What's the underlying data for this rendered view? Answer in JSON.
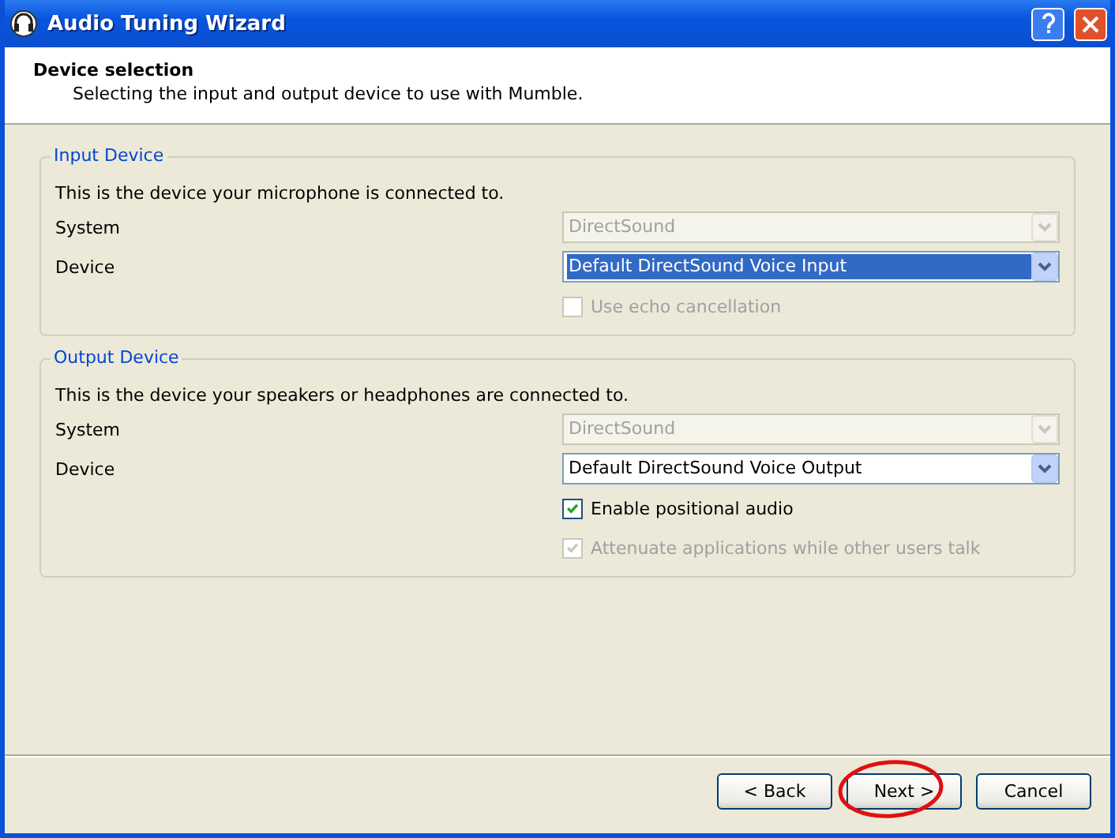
{
  "window": {
    "title": "Audio Tuning Wizard"
  },
  "header": {
    "title": "Device selection",
    "subtitle": "Selecting the input and output device to use with Mumble."
  },
  "groups": [
    {
      "title": "Input Device",
      "description": "This is the device your microphone is connected to.",
      "fields": [
        {
          "label": "System",
          "value": "DirectSound",
          "disabled": true,
          "selected": false
        },
        {
          "label": "Device",
          "value": "Default DirectSound Voice Input",
          "disabled": false,
          "selected": true
        }
      ],
      "checkboxes": [
        {
          "label": "Use echo cancellation",
          "checked": false,
          "disabled": true
        }
      ]
    },
    {
      "title": "Output Device",
      "description": "This is the device your speakers or headphones are connected to.",
      "fields": [
        {
          "label": "System",
          "value": "DirectSound",
          "disabled": true,
          "selected": false
        },
        {
          "label": "Device",
          "value": "Default DirectSound Voice Output",
          "disabled": false,
          "selected": false
        }
      ],
      "checkboxes": [
        {
          "label": "Enable positional audio",
          "checked": true,
          "disabled": false
        },
        {
          "label": "Attenuate applications while other users talk",
          "checked": true,
          "disabled": true
        }
      ]
    }
  ],
  "buttons": [
    {
      "label": "< Back",
      "circled": false
    },
    {
      "label": "Next >",
      "circled": true
    },
    {
      "label": "Cancel",
      "circled": false
    }
  ]
}
